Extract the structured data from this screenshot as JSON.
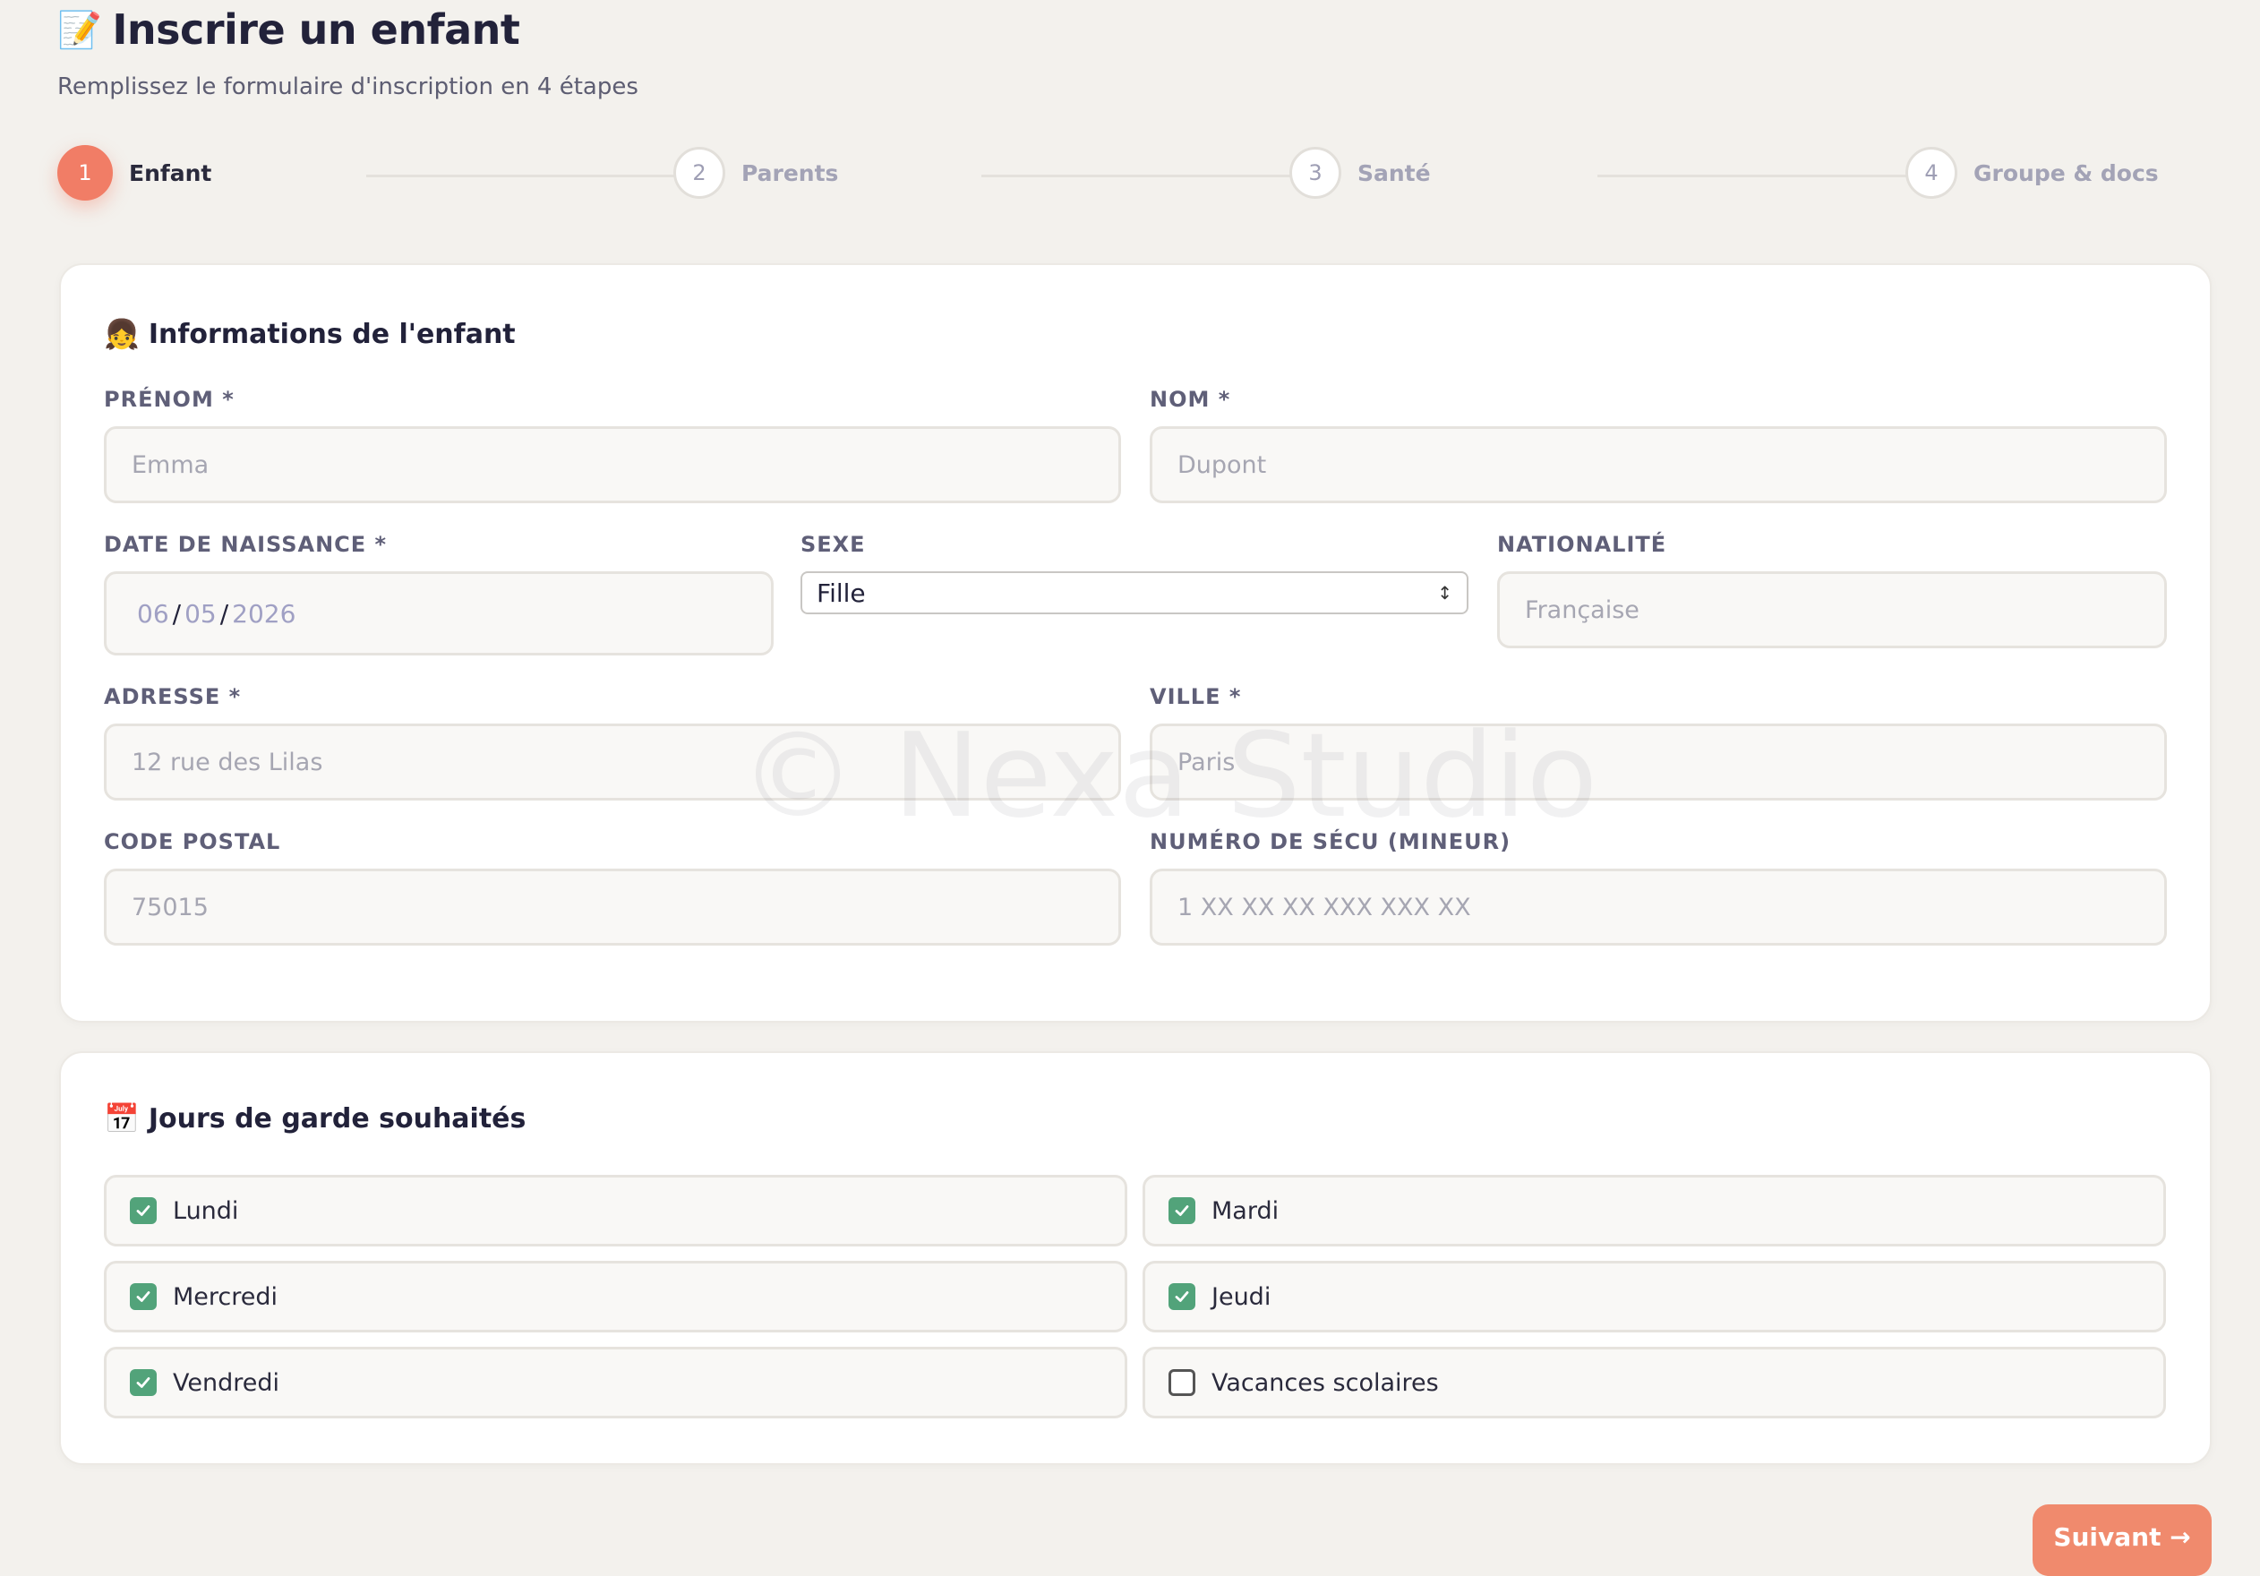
{
  "header": {
    "title_emoji": "📝",
    "title": "Inscrire un enfant",
    "subtitle": "Remplissez le formulaire d'inscription en 4 étapes"
  },
  "stepper": {
    "current": 1,
    "steps": [
      {
        "num": "1",
        "label": "Enfant"
      },
      {
        "num": "2",
        "label": "Parents"
      },
      {
        "num": "3",
        "label": "Santé"
      },
      {
        "num": "4",
        "label": "Groupe & docs"
      }
    ]
  },
  "child_info": {
    "emoji": "👧",
    "title": "Informations de l'enfant",
    "first_name": {
      "label": "PRÉNOM *",
      "placeholder": "Emma",
      "value": ""
    },
    "last_name": {
      "label": "NOM *",
      "placeholder": "Dupont",
      "value": ""
    },
    "birth_date": {
      "label": "DATE DE NAISSANCE *",
      "day": "06",
      "month": "05",
      "year": "2026"
    },
    "sex": {
      "label": "SEXE",
      "value": "Fille"
    },
    "nationality": {
      "label": "NATIONALITÉ",
      "placeholder": "Française",
      "value": ""
    },
    "address": {
      "label": "ADRESSE *",
      "placeholder": "12 rue des Lilas",
      "value": ""
    },
    "city": {
      "label": "VILLE *",
      "placeholder": "Paris",
      "value": ""
    },
    "postal_code": {
      "label": "CODE POSTAL",
      "placeholder": "75015",
      "value": ""
    },
    "ssn": {
      "label": "NUMÉRO DE SÉCU (MINEUR)",
      "placeholder": "1 XX XX XX XXX XXX XX",
      "value": ""
    }
  },
  "care_days": {
    "emoji": "📅",
    "title": "Jours de garde souhaités",
    "days": [
      {
        "label": "Lundi",
        "checked": true
      },
      {
        "label": "Mardi",
        "checked": true
      },
      {
        "label": "Mercredi",
        "checked": true
      },
      {
        "label": "Jeudi",
        "checked": true
      },
      {
        "label": "Vendredi",
        "checked": true
      },
      {
        "label": "Vacances scolaires",
        "checked": false
      }
    ]
  },
  "footer": {
    "next_label": "Suivant →"
  },
  "watermark": "© Nexa Studio",
  "colors": {
    "accent": "#f17d66",
    "check": "#52a37a",
    "background": "#f3f1ed"
  }
}
